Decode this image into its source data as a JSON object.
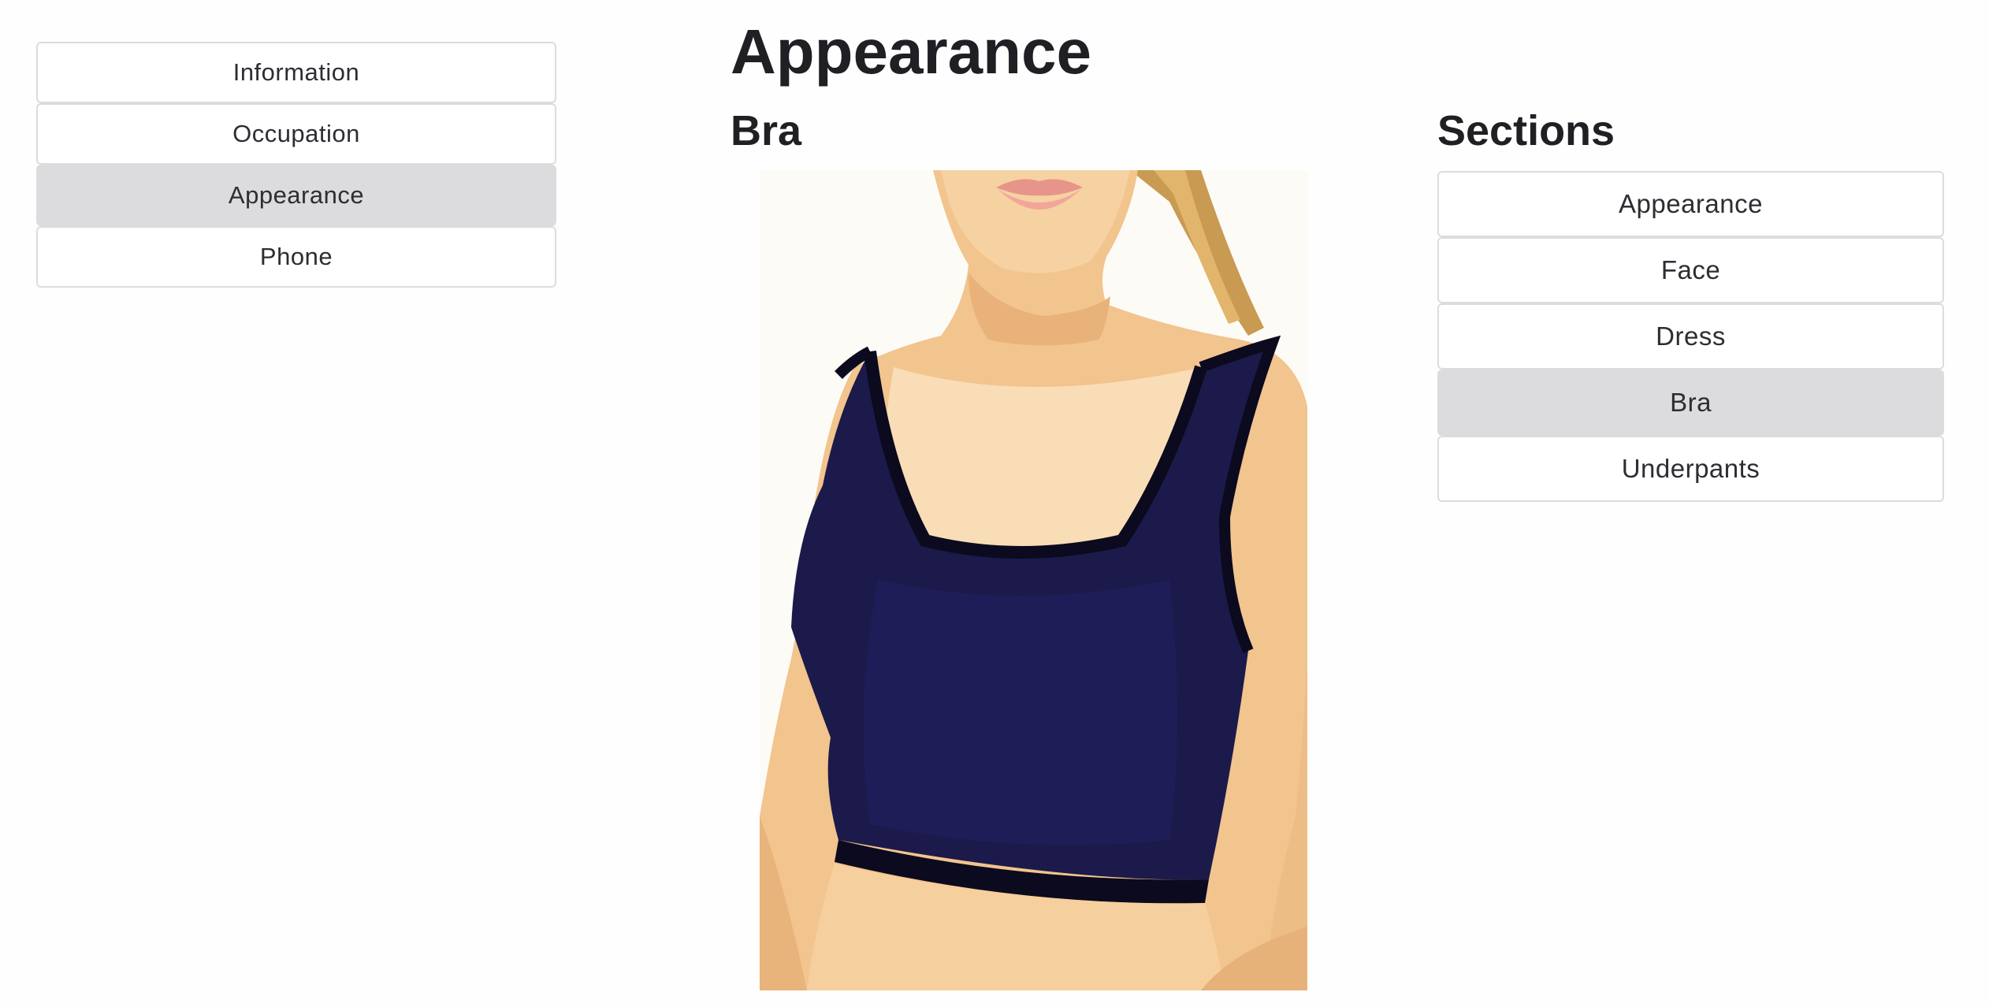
{
  "nav": {
    "items": [
      {
        "label": "Information",
        "active": false
      },
      {
        "label": "Occupation",
        "active": false
      },
      {
        "label": "Appearance",
        "active": true
      },
      {
        "label": "Phone",
        "active": false
      }
    ]
  },
  "main": {
    "title": "Appearance",
    "subtitle": "Bra"
  },
  "sections": {
    "title": "Sections",
    "items": [
      {
        "label": "Appearance",
        "active": false
      },
      {
        "label": "Face",
        "active": false
      },
      {
        "label": "Dress",
        "active": false
      },
      {
        "label": "Bra",
        "active": true
      },
      {
        "label": "Underpants",
        "active": false
      }
    ]
  },
  "colors": {
    "active_bg": "#dcdbde",
    "border": "#dcdcdf",
    "garment": "#1c1a4a",
    "skin": "#f2c48e"
  }
}
